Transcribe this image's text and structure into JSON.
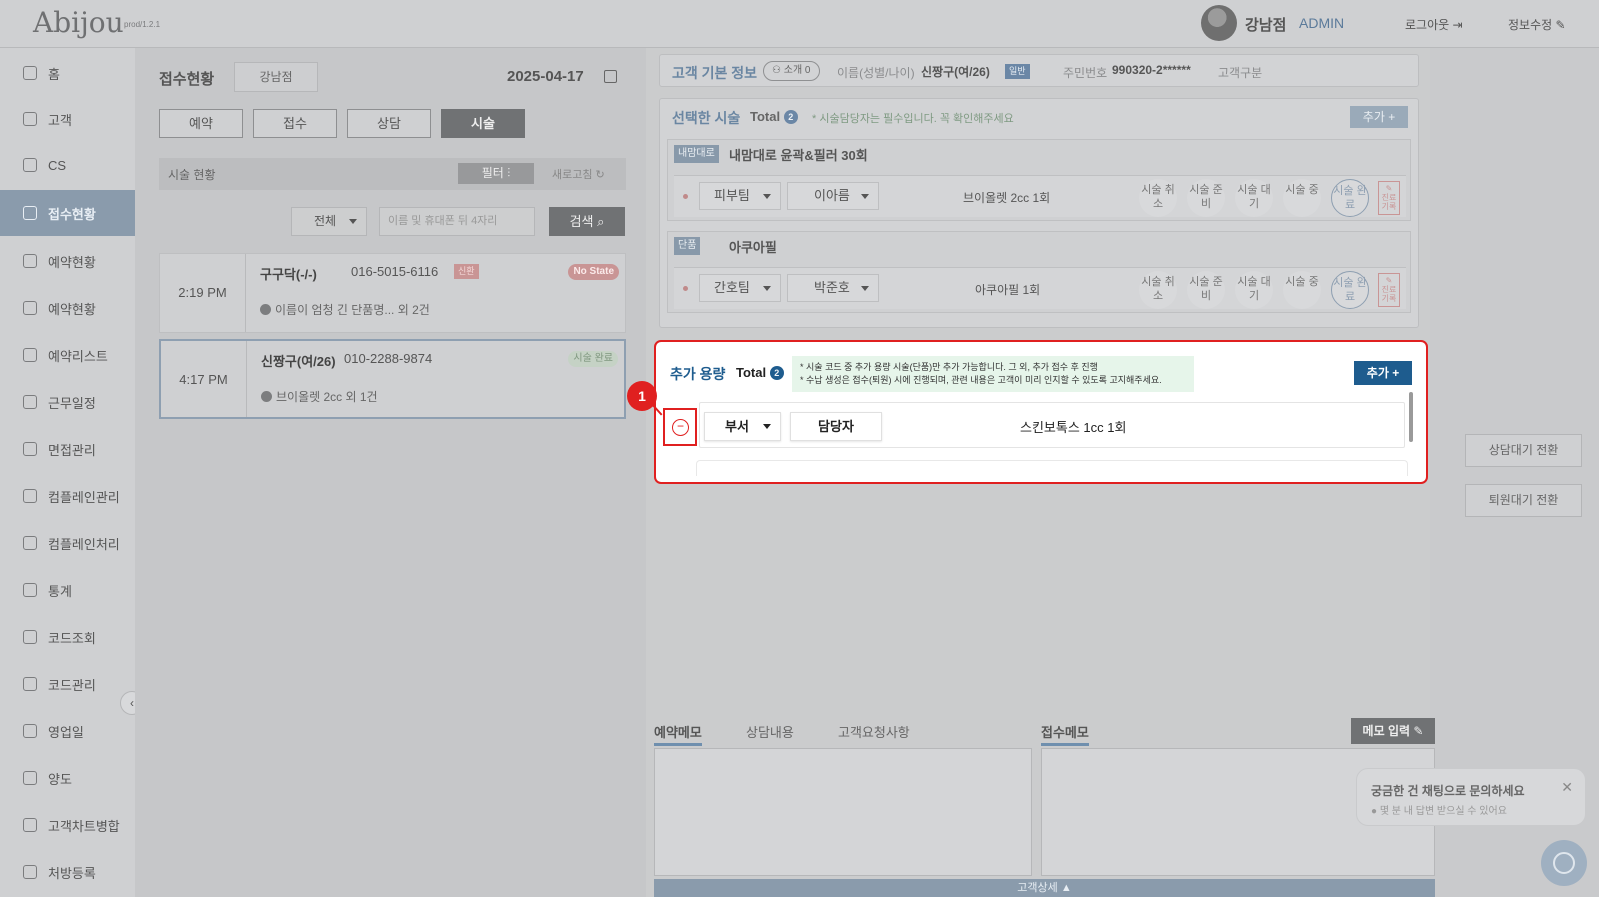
{
  "header": {
    "logo": "Abijou",
    "version": "prod/1.2.1",
    "branch_user": "강남점",
    "role": "ADMIN",
    "logout": "로그아웃",
    "edit_info": "정보수정"
  },
  "sidebar": {
    "items": [
      {
        "label": "홈"
      },
      {
        "label": "고객"
      },
      {
        "label": "CS"
      },
      {
        "label": "접수현황"
      },
      {
        "label": "예약현황"
      },
      {
        "label": "예약현황"
      },
      {
        "label": "예약리스트"
      },
      {
        "label": "근무일정"
      },
      {
        "label": "면접관리"
      },
      {
        "label": "컴플레인관리"
      },
      {
        "label": "컴플레인처리"
      },
      {
        "label": "통계"
      },
      {
        "label": "코드조회"
      },
      {
        "label": "코드관리"
      },
      {
        "label": "영업일"
      },
      {
        "label": "양도"
      },
      {
        "label": "고객차트병합"
      },
      {
        "label": "처방등록"
      }
    ],
    "active_index": 3,
    "collapse_icon": "‹"
  },
  "reception": {
    "title": "접수현황",
    "branch": "강남점",
    "date": "2025-04-17",
    "tabs": [
      "예약",
      "접수",
      "상담",
      "시술"
    ],
    "active_tab": "시술",
    "status_label": "시술 현황",
    "filter_label": "필터",
    "refresh_label": "새로고침",
    "select_value": "전체",
    "search_placeholder": "이름 및 휴대폰 뒤 4자리",
    "search_label": "검색",
    "cards": [
      {
        "time": "2:19 PM",
        "name": "구구닥(-/-)",
        "phone": "016-5015-6116",
        "tag": "신환",
        "state": "No State",
        "sub": "이름이 엄청 긴 단품명... 외 2건"
      },
      {
        "time": "4:17 PM",
        "name": "신짱구(여/26)",
        "phone": "010-2288-9874",
        "tag": "",
        "state": "시술 완료",
        "sub": "브이올렛 2cc 외 1건"
      }
    ]
  },
  "customer": {
    "title": "고객 기본 정보",
    "referral": "소개 0",
    "name_label": "이름(성별/나이)",
    "name_value": "신짱구(여/26)",
    "grade": "일반",
    "rrn_label": "주민번호",
    "rrn_value": "990320-2******",
    "type_label": "고객구분"
  },
  "selected_procedures": {
    "title": "선택한 시술",
    "total_label": "Total",
    "total": "2",
    "note": "* 시술담당자는 필수입니다. 꼭 확인해주세요",
    "add_label": "추가",
    "status_buttons": [
      "시술 취소",
      "시술 준비",
      "시술 대기",
      "시술 중",
      "시술 완료"
    ],
    "record_label": "진료 기록",
    "blocks": [
      {
        "category": "내맘대로",
        "name": "내맘대로 윤곽&필러 30회",
        "dept": "피부팀",
        "staff": "이아름",
        "desc": "브이올렛 2cc 1회"
      },
      {
        "category": "단품",
        "name": "아쿠아필",
        "dept": "간호팀",
        "staff": "박준호",
        "desc": "아쿠아필 1회"
      }
    ]
  },
  "additional": {
    "title": "추가 용량",
    "total_label": "Total",
    "total": "2",
    "note_line1": "* 시술 코드 중 추가 용량 시술(단품)만 추가 가능합니다. 그 외, 추가 접수 후 진행",
    "note_line2": "* 수납 생성은 접수(퇴원) 시에 진행되며, 관련 내용은 고객이 미리 인지할 수 있도록 고지해주세요.",
    "add_label": "추가 +",
    "row": {
      "dept": "부서",
      "staff": "담당자",
      "desc": "스킨보톡스 1cc 1회"
    },
    "remove_icon": "−",
    "step": "1"
  },
  "memo": {
    "tabs": [
      "예약메모",
      "상담내용",
      "고객요청사항"
    ],
    "reception_memo": "접수메모",
    "memo_button": "메모 입력",
    "customer_detail": "고객상세 ▲"
  },
  "right_panel": {
    "consult_wait": "상담대기 전환",
    "leave_wait": "퇴원대기 전환",
    "chat_message": "궁금한 건 채팅으로 문의하세요",
    "chat_sub": "● 몇 분 내 답변 받으실 수 있어요",
    "chat_close": "✕"
  }
}
